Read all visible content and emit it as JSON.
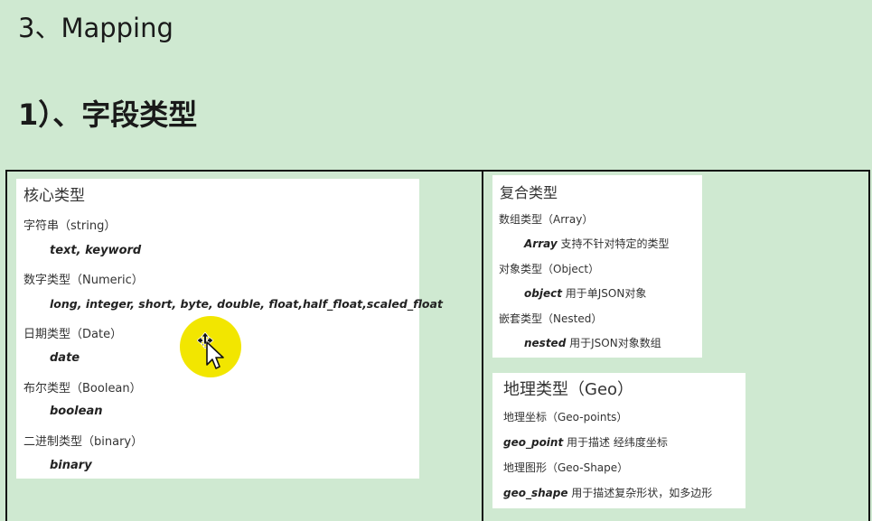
{
  "heading": {
    "main": "3、Mapping",
    "sub": "1）、字段类型"
  },
  "core": {
    "title": "核心类型",
    "rows": [
      {
        "label": "字符串（string）",
        "value": "text, keyword"
      },
      {
        "label": "数字类型（Numeric）",
        "value": "long, integer, short, byte, double, float,half_float,scaled_float"
      },
      {
        "label": "日期类型（Date）",
        "value": "date"
      },
      {
        "label": "布尔类型（Boolean）",
        "value": "boolean"
      },
      {
        "label": "二进制类型（binary）",
        "value": "binary"
      }
    ]
  },
  "complex": {
    "title": "复合类型",
    "rows": [
      {
        "label": "数组类型（Array）",
        "value": "Array",
        "desc": " 支持不针对特定的类型"
      },
      {
        "label": "对象类型（Object）",
        "value": "object",
        "desc": " 用于单JSON对象"
      },
      {
        "label": "嵌套类型（Nested）",
        "value": "nested",
        "desc": " 用于JSON对象数组"
      }
    ]
  },
  "geo": {
    "title": "地理类型（Geo）",
    "rows": [
      {
        "label": "地理坐标（Geo-points）",
        "value": "geo_point",
        "desc": " 用于描述 经纬度坐标"
      },
      {
        "label": "地理图形（Geo-Shape）",
        "value": "geo_shape",
        "desc": " 用于描述复杂形状，如多边形"
      }
    ]
  },
  "colors": {
    "background": "#cfe9d1",
    "card": "#ffffff",
    "cursor_highlight": "#f2e600"
  },
  "icons": {
    "cursor": "move-cursor-icon"
  }
}
